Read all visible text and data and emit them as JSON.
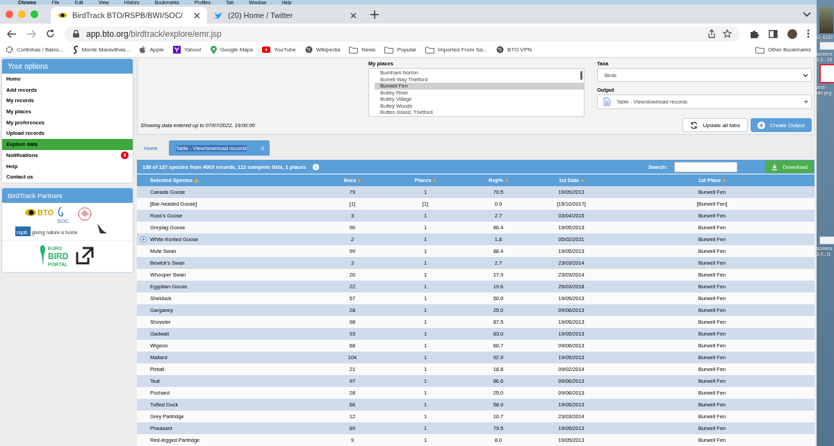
{
  "menu_bar": [
    "Chrome",
    "File",
    "Edit",
    "View",
    "History",
    "Bookmarks",
    "Profiles",
    "Tab",
    "Window",
    "Help"
  ],
  "browser_tabs": [
    {
      "title": "BirdTrack BTO/RSPB/BWI/SOC/",
      "selected": true
    },
    {
      "title": "(20) Home / Twitter",
      "selected": false
    }
  ],
  "address": {
    "host": "app.bto.org",
    "path": "/birdtrack/explore/emr.jsp"
  },
  "bookmarks": [
    "Cortinhas / Baixo...",
    "Monte Maravilhas...",
    "Apple",
    "Yahoo!",
    "Google Maps",
    "YouTube",
    "Wikipedia",
    "News",
    "Popular",
    "Imported From Sa...",
    "BTO VPN"
  ],
  "other_bookmarks": "Other Bookmarks",
  "desktop_labels": [
    "G_6150",
    "screens",
    "2-0...18",
    "and-",
    "del.png",
    "screens",
    "2-0...t1"
  ],
  "sidebar": {
    "title": "Your options",
    "items": [
      {
        "label": "Home",
        "selected": false
      },
      {
        "label": "Add records",
        "selected": false
      },
      {
        "label": "My records",
        "selected": false
      },
      {
        "label": "My places",
        "selected": false
      },
      {
        "label": "My preferences",
        "selected": false
      },
      {
        "label": "Upload records",
        "selected": false
      },
      {
        "label": "Explore data",
        "selected": true
      },
      {
        "label": "Notifications",
        "selected": false,
        "badge": "9"
      },
      {
        "label": "Help",
        "selected": false
      },
      {
        "label": "Contact us",
        "selected": false
      }
    ]
  },
  "partners": {
    "title": "BirdTrack Partners",
    "logos": [
      "BTO",
      "SOC",
      "rspb",
      "giving nature a home",
      "EURO",
      "BIRD",
      "PORTAL"
    ]
  },
  "filters": {
    "places_label": "My places",
    "places": [
      {
        "name": "Burnham Norton",
        "selected": false
      },
      {
        "name": "Burrell Way Thetford",
        "selected": false
      },
      {
        "name": "Burwell Fen",
        "selected": true
      },
      {
        "name": "Butley River",
        "selected": false
      },
      {
        "name": "Butley Village",
        "selected": false
      },
      {
        "name": "Butley Woods",
        "selected": false
      },
      {
        "name": "Butten Island, Thetford",
        "selected": false
      }
    ],
    "taxa_label": "Taxa",
    "taxa": "Birds",
    "output_label": "Output",
    "output": "Table - View/download records",
    "note": "Showing data entered up to 07/07/2022, 19:00:00",
    "buttons": [
      "Update all tabs",
      "Create Output"
    ]
  },
  "page_tabs": [
    {
      "label": "Home",
      "selected": false
    },
    {
      "label": "Table - View/download records",
      "selected": true,
      "close": "X"
    }
  ],
  "summary": "136 of 137 species from 4003 records, 112 complete lists, 1 places",
  "search_label": "Search:",
  "download": "Download",
  "table": {
    "columns": [
      "Selected Species",
      "Recs",
      "Places",
      "Rep%",
      "1st Date",
      "1st Place"
    ],
    "rows": [
      {
        "cells": [
          "Canada Goose",
          "79",
          "1",
          "70.5",
          "19/05/2013",
          "Burwell Fen"
        ],
        "expand": false
      },
      {
        "cells": [
          "[Bar-headed Goose]",
          "[1]",
          "[1]",
          "0.9",
          "[15/10/2017]",
          "[Burwell Fen]"
        ],
        "expand": false
      },
      {
        "cells": [
          "Ross's Goose",
          "3",
          "1",
          "2.7",
          "03/04/2015",
          "Burwell Fen"
        ],
        "expand": false
      },
      {
        "cells": [
          "Greylag Goose",
          "90",
          "1",
          "80.4",
          "19/05/2013",
          "Burwell Fen"
        ],
        "expand": false
      },
      {
        "cells": [
          "White-fronted Goose",
          "2",
          "1",
          "1.8",
          "05/02/2021",
          "Burwell Fen"
        ],
        "expand": true
      },
      {
        "cells": [
          "Mute Swan",
          "99",
          "1",
          "88.4",
          "19/05/2013",
          "Burwell Fen"
        ],
        "expand": false
      },
      {
        "cells": [
          "Bewick's Swan",
          "3",
          "1",
          "2.7",
          "23/03/2014",
          "Burwell Fen"
        ],
        "expand": false
      },
      {
        "cells": [
          "Whooper Swan",
          "20",
          "1",
          "17.9",
          "23/03/2014",
          "Burwell Fen"
        ],
        "expand": false
      },
      {
        "cells": [
          "Egyptian Goose",
          "22",
          "1",
          "19.6",
          "25/03/2018",
          "Burwell Fen"
        ],
        "expand": false
      },
      {
        "cells": [
          "Shelduck",
          "57",
          "1",
          "50.9",
          "19/05/2013",
          "Burwell Fen"
        ],
        "expand": false
      },
      {
        "cells": [
          "Garganey",
          "28",
          "1",
          "25.0",
          "09/06/2013",
          "Burwell Fen"
        ],
        "expand": false
      },
      {
        "cells": [
          "Shoveler",
          "98",
          "1",
          "87.5",
          "19/05/2013",
          "Burwell Fen"
        ],
        "expand": false
      },
      {
        "cells": [
          "Gadwall",
          "93",
          "1",
          "83.0",
          "19/05/2013",
          "Burwell Fen"
        ],
        "expand": false
      },
      {
        "cells": [
          "Wigeon",
          "68",
          "1",
          "60.7",
          "09/06/2013",
          "Burwell Fen"
        ],
        "expand": false
      },
      {
        "cells": [
          "Mallard",
          "104",
          "1",
          "92.9",
          "19/05/2013",
          "Burwell Fen"
        ],
        "expand": false
      },
      {
        "cells": [
          "Pintail",
          "21",
          "1",
          "18.8",
          "09/02/2014",
          "Burwell Fen"
        ],
        "expand": false
      },
      {
        "cells": [
          "Teal",
          "97",
          "1",
          "86.6",
          "09/06/2013",
          "Burwell Fen"
        ],
        "expand": false
      },
      {
        "cells": [
          "Pochard",
          "28",
          "1",
          "25.0",
          "09/06/2013",
          "Burwell Fen"
        ],
        "expand": false
      },
      {
        "cells": [
          "Tufted Duck",
          "66",
          "1",
          "58.9",
          "19/05/2013",
          "Burwell Fen"
        ],
        "expand": false
      },
      {
        "cells": [
          "Grey Partridge",
          "12",
          "1",
          "10.7",
          "23/03/2014",
          "Burwell Fen"
        ],
        "expand": false
      },
      {
        "cells": [
          "Pheasant",
          "89",
          "1",
          "79.5",
          "19/05/2013",
          "Burwell Fen"
        ],
        "expand": false
      },
      {
        "cells": [
          "Red-legged Partridge",
          "9",
          "1",
          "8.0",
          "19/05/2013",
          "Burwell Fen"
        ],
        "expand": false
      }
    ]
  }
}
